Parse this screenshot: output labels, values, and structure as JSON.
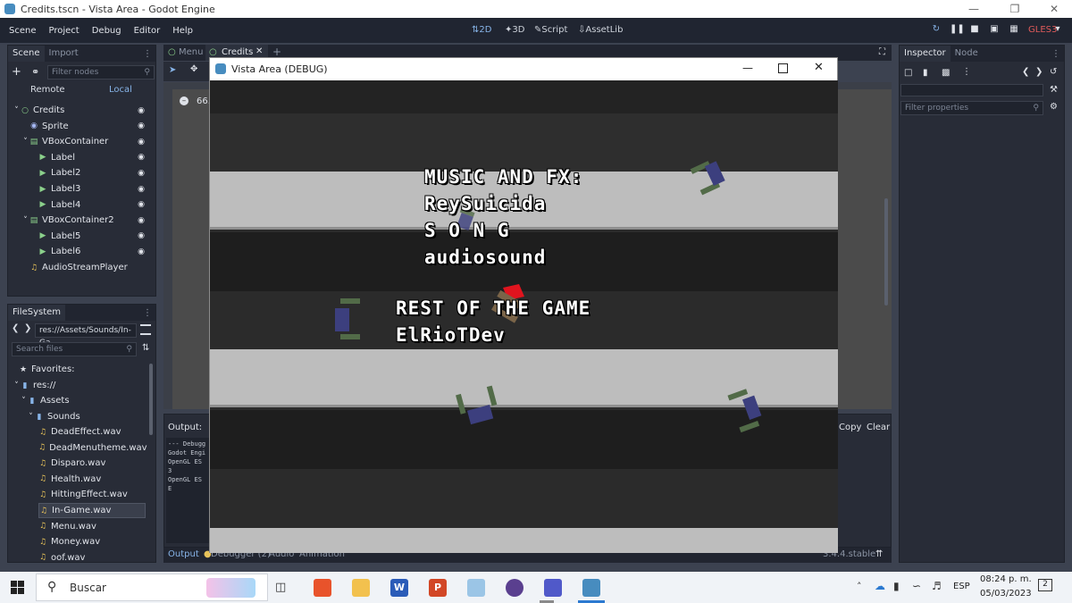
{
  "window": {
    "title": "Credits.tscn - Vista Area - Godot Engine"
  },
  "menu": [
    "Scene",
    "Project",
    "Debug",
    "Editor",
    "Help"
  ],
  "workspaces": {
    "d2": "2D",
    "d3": "3D",
    "script": "Script",
    "assetlib": "AssetLib"
  },
  "renderer": "GLES3",
  "scene_dock": {
    "tabs": [
      "Scene",
      "Import"
    ],
    "filter_placeholder": "Filter nodes",
    "remote": "Remote",
    "local": "Local",
    "nodes": [
      {
        "label": "Credits",
        "depth": 0,
        "kind": "node2d"
      },
      {
        "label": "Sprite",
        "depth": 1,
        "kind": "sprite"
      },
      {
        "label": "VBoxContainer",
        "depth": 1,
        "kind": "vbox"
      },
      {
        "label": "Label",
        "depth": 2,
        "kind": "label"
      },
      {
        "label": "Label2",
        "depth": 2,
        "kind": "label"
      },
      {
        "label": "Label3",
        "depth": 2,
        "kind": "label"
      },
      {
        "label": "Label4",
        "depth": 2,
        "kind": "label"
      },
      {
        "label": "VBoxContainer2",
        "depth": 1,
        "kind": "vbox"
      },
      {
        "label": "Label5",
        "depth": 2,
        "kind": "label"
      },
      {
        "label": "Label6",
        "depth": 2,
        "kind": "label"
      },
      {
        "label": "AudioStreamPlayer",
        "depth": 1,
        "kind": "audio"
      }
    ]
  },
  "filesystem": {
    "tab": "FileSystem",
    "path": "res://Assets/Sounds/In-Ga",
    "search_placeholder": "Search files",
    "favorites": "Favorites:",
    "res": "res://",
    "assets": "Assets",
    "sounds": "Sounds",
    "files": [
      "DeadEffect.wav",
      "DeadMenutheme.wav",
      "Disparo.wav",
      "Health.wav",
      "HittingEffect.wav",
      "In-Game.wav",
      "Menu.wav",
      "Money.wav",
      "oof.wav"
    ],
    "selected": "In-Game.wav"
  },
  "editor_tabs": {
    "menu": "Menu",
    "credits": "Credits"
  },
  "viewport": {
    "zoom": "66."
  },
  "output": {
    "title": "Output:",
    "lines": [
      "--- Debugg",
      "Godot Engi",
      "OpenGL ES 3",
      "OpenGL ES E"
    ],
    "copy": "Copy",
    "clear": "Clear"
  },
  "bottom_tabs": [
    "Output",
    "Debugger (2)",
    "Audio",
    "Animation"
  ],
  "version": "3.4.4.stable",
  "inspector": {
    "tabs": [
      "Inspector",
      "Node"
    ],
    "filter_placeholder": "Filter properties"
  },
  "game_window": {
    "title": "Vista Area (DEBUG)"
  },
  "credits": {
    "music_heading": "MUSIC AND FX:",
    "music_1": "ReySuicida",
    "music_2": "S O N G",
    "music_3": "audiosound",
    "rest_heading": "REST OF THE GAME",
    "rest_1": "ElRioTDev"
  },
  "colors": {
    "stripe_light": "#bdbdbd",
    "stripe_dark": "#242424",
    "bracket_green": "#526b48",
    "bracket_blue": "#3c3f7e",
    "accent_red": "#e0141e"
  },
  "taskbar": {
    "search": "Buscar",
    "lang": "ESP",
    "time": "08:24 p. m.",
    "date": "05/03/2023",
    "notifications": "2"
  }
}
